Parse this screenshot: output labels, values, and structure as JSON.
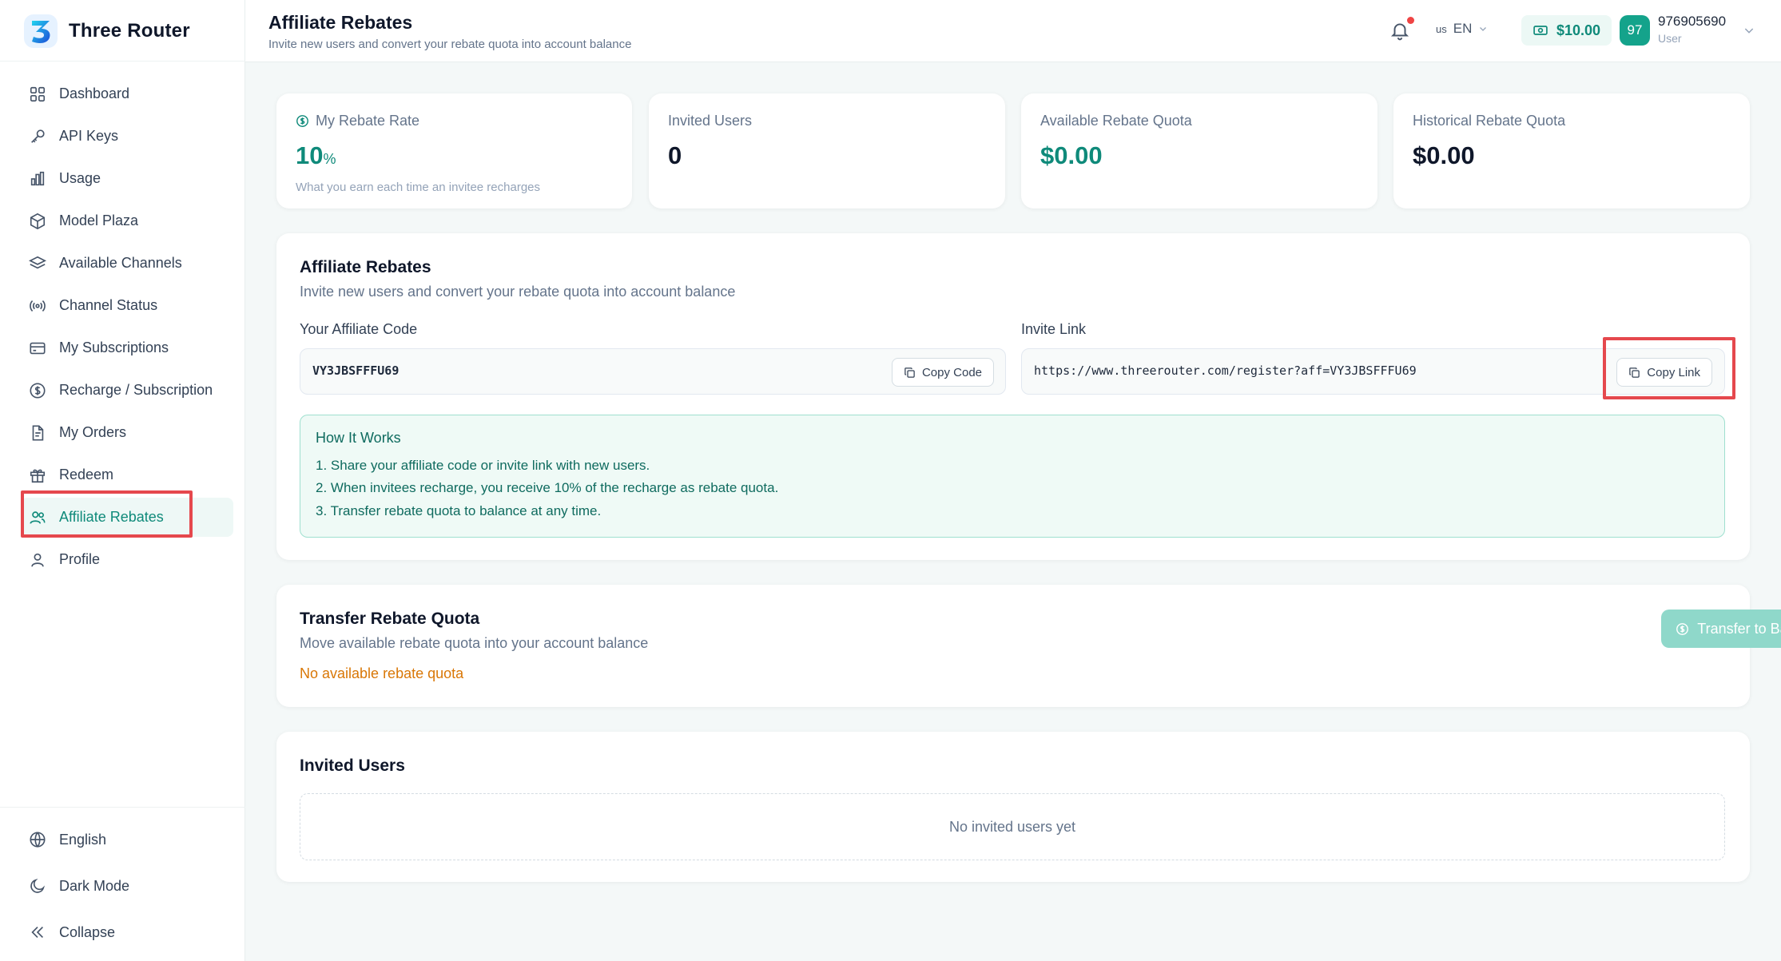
{
  "brand": {
    "name": "Three Router",
    "logo_icon": "three-router-logo"
  },
  "sidebar": {
    "items": [
      {
        "label": "Dashboard",
        "icon": "grid-icon"
      },
      {
        "label": "API Keys",
        "icon": "key-icon"
      },
      {
        "label": "Usage",
        "icon": "bar-chart-icon"
      },
      {
        "label": "Model Plaza",
        "icon": "cube-icon"
      },
      {
        "label": "Available Channels",
        "icon": "layers-icon"
      },
      {
        "label": "Channel Status",
        "icon": "broadcast-icon"
      },
      {
        "label": "My Subscriptions",
        "icon": "credit-card-icon"
      },
      {
        "label": "Recharge / Subscription",
        "icon": "dollar-circle-icon"
      },
      {
        "label": "My Orders",
        "icon": "document-icon"
      },
      {
        "label": "Redeem",
        "icon": "gift-icon"
      },
      {
        "label": "Affiliate Rebates",
        "icon": "users-icon",
        "active": true
      },
      {
        "label": "Profile",
        "icon": "user-icon"
      }
    ],
    "bottom": [
      {
        "label": "English",
        "icon": "globe-icon"
      },
      {
        "label": "Dark Mode",
        "icon": "moon-icon"
      },
      {
        "label": "Collapse",
        "icon": "double-chevron-left-icon"
      }
    ]
  },
  "header": {
    "title": "Affiliate Rebates",
    "subtitle": "Invite new users and convert your rebate quota into account balance",
    "lang_flag": "us",
    "lang_code": "EN",
    "balance": "$10.00",
    "avatar_text": "97",
    "username": "976905690",
    "role": "User"
  },
  "stats": [
    {
      "label": "My Rebate Rate",
      "value": "10",
      "unit": "%",
      "hint": "What you earn each time an invitee recharges"
    },
    {
      "label": "Invited Users",
      "value": "0"
    },
    {
      "label": "Available Rebate Quota",
      "value": "$0.00"
    },
    {
      "label": "Historical Rebate Quota",
      "value": "$0.00"
    }
  ],
  "affiliate": {
    "title": "Affiliate Rebates",
    "subtitle": "Invite new users and convert your rebate quota into account balance",
    "code_label": "Your Affiliate Code",
    "code_value": "VY3JBSFFFU69",
    "copy_code": "Copy Code",
    "link_label": "Invite Link",
    "link_value": "https://www.threerouter.com/register?aff=VY3JBSFFFU69",
    "copy_link": "Copy Link",
    "how_title": "How It Works",
    "steps": [
      "1. Share your affiliate code or invite link with new users.",
      "2. When invitees recharge, you receive 10% of the recharge as rebate quota.",
      "3. Transfer rebate quota to balance at any time."
    ]
  },
  "transfer": {
    "title": "Transfer Rebate Quota",
    "subtitle": "Move available rebate quota into your account balance",
    "warning": "No available rebate quota",
    "button": "Transfer to Balance"
  },
  "invited": {
    "title": "Invited Users",
    "empty": "No invited users yet"
  },
  "colors": {
    "accent": "#0f8a7a",
    "accent_light": "#8fd8ca",
    "warning": "#d97706",
    "highlight": "#e5484d"
  }
}
